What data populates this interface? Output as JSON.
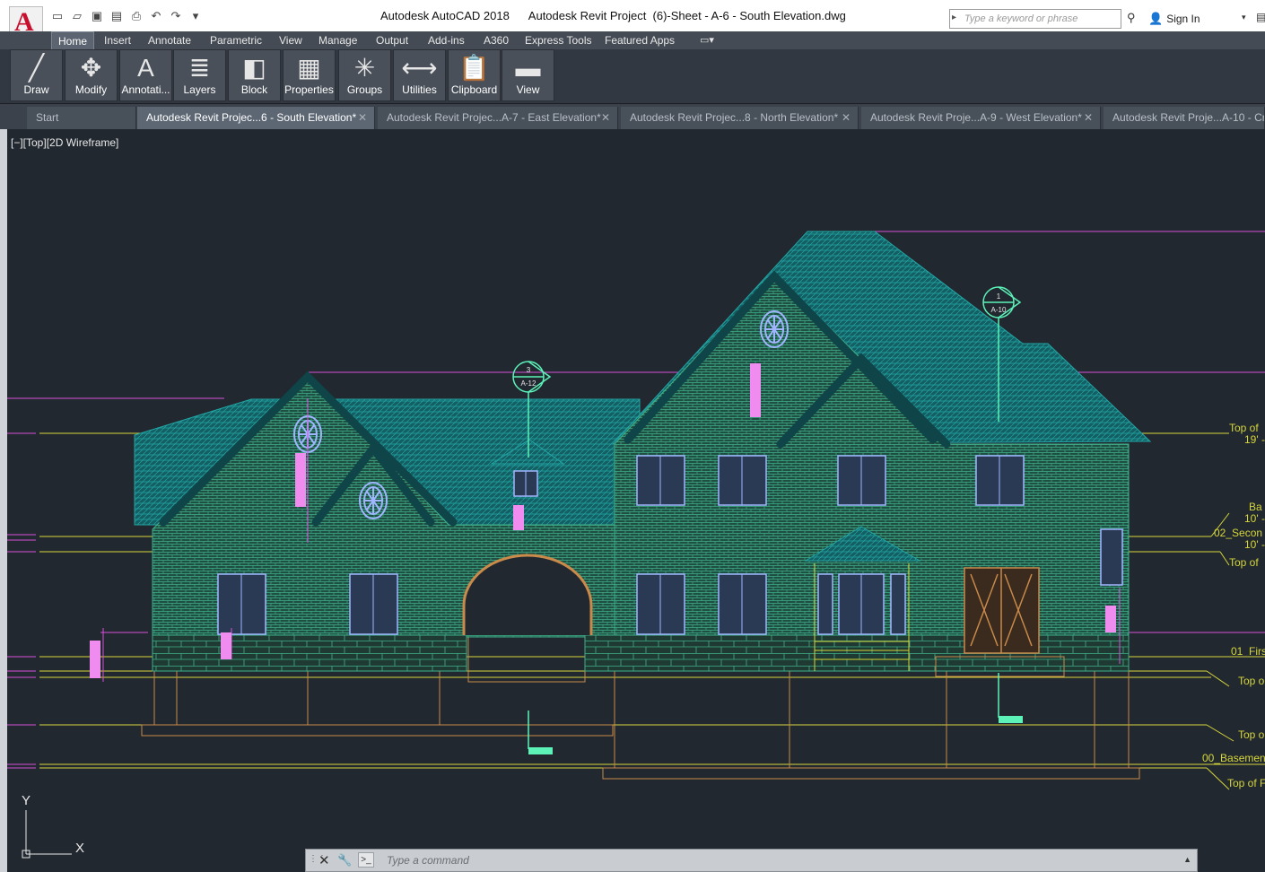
{
  "window": {
    "app_title": "Autodesk AutoCAD 2018",
    "doc_title": "Autodesk Revit Project  (6)-Sheet - A-6 - South Elevation.dwg"
  },
  "search": {
    "placeholder": "Type a keyword or phrase"
  },
  "account": {
    "sign_in": "Sign In"
  },
  "ribbon_tabs": [
    "Home",
    "Insert",
    "Annotate",
    "Parametric",
    "View",
    "Manage",
    "Output",
    "Add-ins",
    "A360",
    "Express Tools",
    "Featured Apps"
  ],
  "panels": [
    {
      "label": "Draw",
      "icon": "line-icon"
    },
    {
      "label": "Modify",
      "icon": "move-icon"
    },
    {
      "label": "Annotati...",
      "icon": "text-a-icon"
    },
    {
      "label": "Layers",
      "icon": "layers-icon"
    },
    {
      "label": "Block",
      "icon": "block-icon"
    },
    {
      "label": "Properties",
      "icon": "properties-icon"
    },
    {
      "label": "Groups",
      "icon": "groups-icon"
    },
    {
      "label": "Utilities",
      "icon": "measure-icon"
    },
    {
      "label": "Clipboard",
      "icon": "clipboard-icon"
    },
    {
      "label": "View",
      "icon": "folder-icon"
    }
  ],
  "doc_tabs": [
    {
      "label": "Start",
      "active": false
    },
    {
      "label": "Autodesk Revit Projec...6 - South Elevation*",
      "active": true
    },
    {
      "label": "Autodesk Revit Projec...A-7 - East Elevation*",
      "active": false
    },
    {
      "label": "Autodesk Revit Projec...8 - North Elevation*",
      "active": false
    },
    {
      "label": "Autodesk Revit Proje...A-9 - West Elevation*",
      "active": false
    },
    {
      "label": "Autodesk Revit Proje...A-10 - Cro",
      "active": false
    }
  ],
  "viewport": {
    "label": "[−][Top][2D Wireframe]",
    "section_marks": [
      {
        "number": "3",
        "sheet": "A-12"
      },
      {
        "number": "1",
        "sheet": "A-10"
      }
    ],
    "level_labels": [
      "Top of",
      "19' -",
      "Ba",
      "10' -",
      "02_Secon",
      "10' -",
      "Top of",
      "01_Firs",
      "Top o",
      "Top o",
      "00_Basemen",
      "Top of F"
    ],
    "ucs": {
      "x": "X",
      "y": "Y"
    }
  },
  "command": {
    "placeholder": "Type a command"
  },
  "colors": {
    "background": "#212830",
    "roof": "#1a8a8a",
    "brick": "#2f8a6a",
    "level_line": "#d6d63a",
    "magenta": "#d84fd8",
    "window": "#9fb6ff",
    "wood": "#c98a4a"
  }
}
